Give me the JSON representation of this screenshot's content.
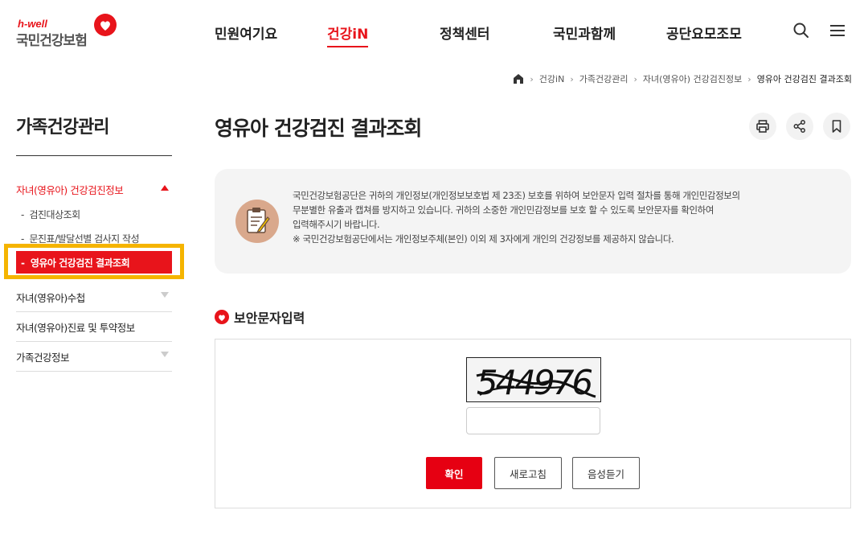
{
  "logo": {
    "sub": "h-well",
    "name": "국민건강보험"
  },
  "gnb": [
    {
      "label": "민원여기요",
      "active": false
    },
    {
      "label": "건강iN",
      "active": true
    },
    {
      "label": "정책센터",
      "active": false
    },
    {
      "label": "국민과함께",
      "active": false
    },
    {
      "label": "공단요모조모",
      "active": false
    }
  ],
  "breadcrumb": [
    "건강iN",
    "가족건강관리",
    "자녀(영유아) 건강검진정보",
    "영유아 건강검진 결과조회"
  ],
  "lnb": {
    "title": "가족건강관리",
    "group1": "자녀(영유아) 건강검진정보",
    "sub1": "검진대상조회",
    "sub2": "문진표/발달선별 검사지 작성",
    "active": "영유아 건강검진 결과조회",
    "item2": "자녀(영유아)수첩",
    "item3": "자녀(영유아)진료 및 투약정보",
    "item4": "가족건강정보"
  },
  "page": {
    "title": "영유아 건강검진 결과조회"
  },
  "notice": {
    "line1": "국민건강보험공단은 귀하의 개인정보(개인정보보호법 제 23조) 보호를 위하여 보안문자 입력 절차를 통해 개인민감정보의",
    "line2": "무분별한 유출과 캡쳐를 방지하고 있습니다. 귀하의 소중한 개인민감정보를 보호 할 수 있도록 보안문자를 확인하여",
    "line3": "입력해주시기 바랍니다.",
    "line4": "※ 국민건강보험공단에서는 개인정보주체(본인) 이외 제 3자에게 개인의 건강정보를 제공하지 않습니다."
  },
  "captcha": {
    "section_title": "보안문자입력",
    "code": "544976",
    "input_value": "",
    "confirm": "확인",
    "refresh": "새로고침",
    "audio": "음성듣기"
  },
  "colors": {
    "accent": "#e8141b",
    "highlight": "#f5b400"
  }
}
